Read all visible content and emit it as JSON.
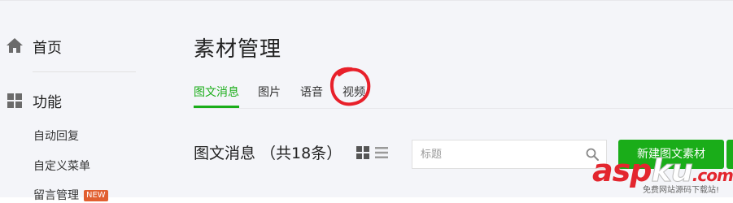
{
  "sidebar": {
    "home_label": "首页",
    "function_label": "功能",
    "items": [
      {
        "label": "自动回复"
      },
      {
        "label": "自定义菜单"
      },
      {
        "label": "留言管理",
        "badge": "NEW"
      }
    ]
  },
  "main": {
    "title": "素材管理",
    "tabs": [
      {
        "label": "图文消息",
        "active": true
      },
      {
        "label": "图片",
        "active": false
      },
      {
        "label": "语音",
        "active": false
      },
      {
        "label": "视频",
        "active": false
      }
    ],
    "section_title": "图文消息 （共18条）",
    "search": {
      "placeholder": "标题",
      "value": ""
    },
    "new_button_label": "新建图文素材"
  },
  "annotation": {
    "highlighted_tab": "视频",
    "circle_color": "#e8202a"
  },
  "watermark": {
    "logo_red_1": "asp",
    "logo_white": "ku",
    "logo_red_2": ".com",
    "subtitle": "免费网站源码下载站!"
  },
  "colors": {
    "accent": "#1aad19",
    "background": "#f4f5f9",
    "badge": "#e15f30"
  },
  "icons": {
    "home": "home-icon",
    "function": "grid-squares-icon",
    "search": "search-icon",
    "view_grid": "grid-view-icon",
    "view_list": "list-view-icon"
  }
}
